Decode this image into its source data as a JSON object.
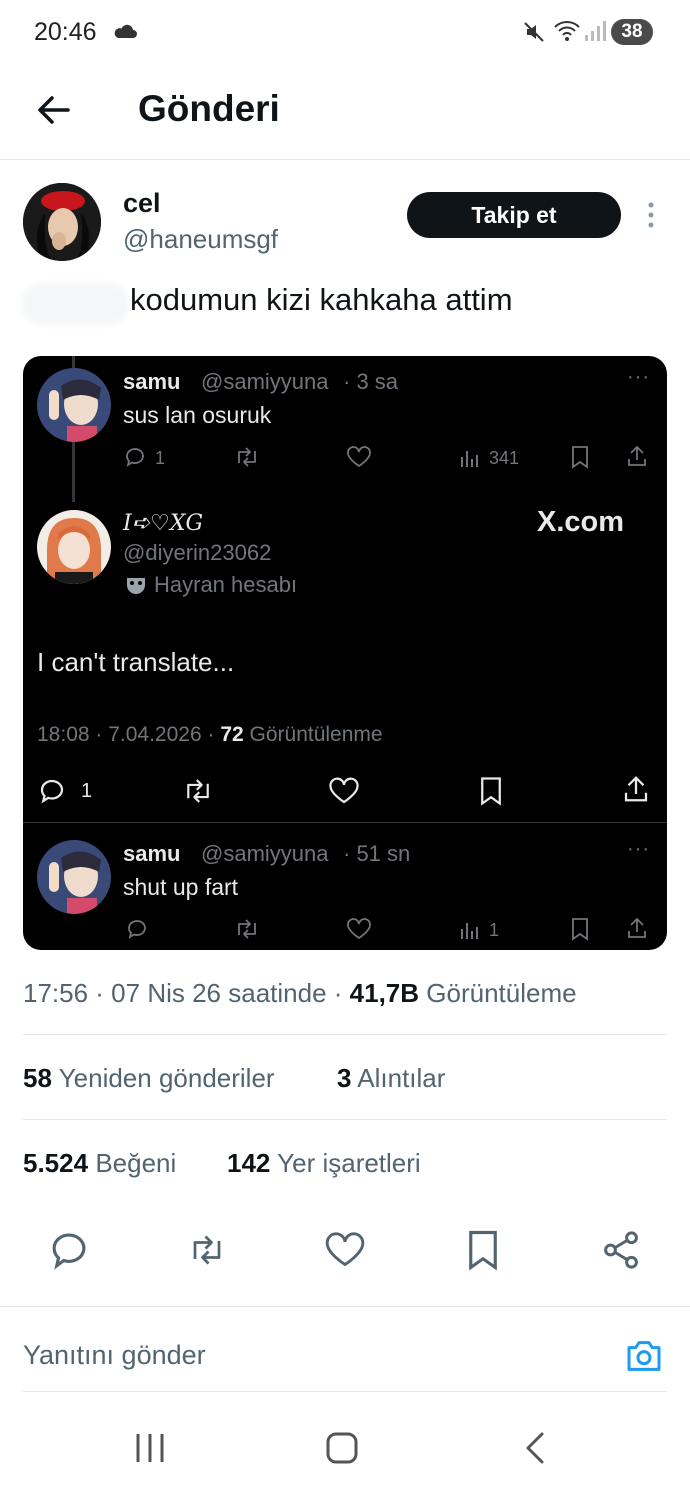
{
  "status_bar": {
    "time": "20:46",
    "battery": "38"
  },
  "header": {
    "title": "Gönderi"
  },
  "author": {
    "name": "cel",
    "handle": "@haneumsgf",
    "follow_label": "Takip et"
  },
  "tweet": {
    "text": "kodumun kizi kahkaha attim"
  },
  "embed": {
    "first": {
      "name": "samu",
      "handle": "@samiyyuna",
      "time": "· 3 sa",
      "text": "sus lan osuruk",
      "replies": "1",
      "views": "341"
    },
    "main": {
      "name": "I➪♡XG",
      "handle": "@diyerin23062",
      "fan_label": "Hayran hesabı",
      "brand": "X.com",
      "text": "I can't translate...",
      "date": "18:08 · 7.04.2026 ·",
      "views_count": "72",
      "views_label": "Görüntülenme",
      "replies": "1"
    },
    "reply": {
      "name": "samu",
      "handle": "@samiyyuna",
      "time": "· 51 sn",
      "text": "shut up fart",
      "views": "1"
    }
  },
  "stats": {
    "timestamp": "17:56 · 07 Nis 26 saatinde ·",
    "views_count": "41,7B",
    "views_label": "Görüntüleme",
    "reposts_count": "58",
    "reposts_label": "Yeniden gönderiler",
    "quotes_count": "3",
    "quotes_label": "Alıntılar",
    "likes_count": "5.524",
    "likes_label": "Beğeni",
    "bookmarks_count": "142",
    "bookmarks_label": "Yer işaretleri"
  },
  "reply_box": {
    "placeholder": "Yanıtını gönder"
  },
  "colors": {
    "text": "#0f1419",
    "muted": "#536471",
    "accent": "#1d9bf0",
    "embed_bg": "#000000"
  }
}
